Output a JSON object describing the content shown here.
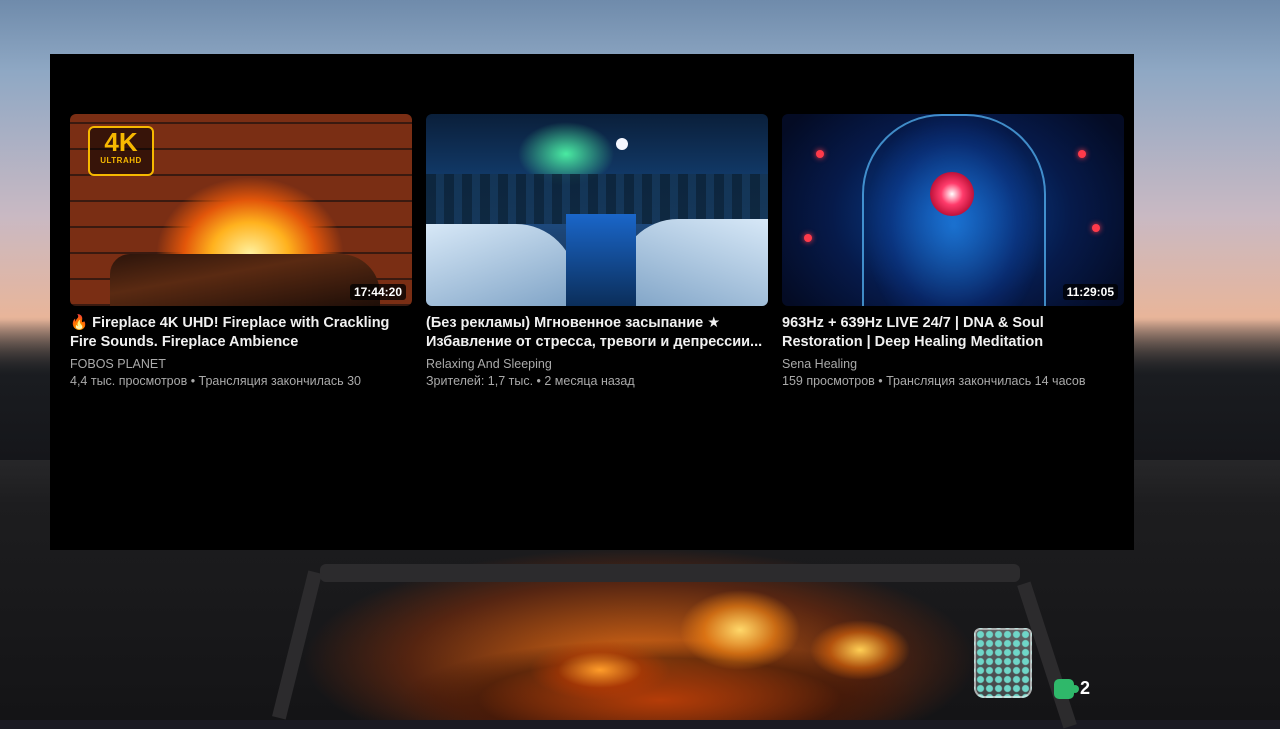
{
  "end_screen": {
    "cards": [
      {
        "title": "🔥 Fireplace 4K UHD! Fireplace with Crackling Fire Sounds. Fireplace Ambience",
        "channel": "FOBOS PLANET",
        "meta": "4,4 тыс. просмотров • Трансляция закончилась 30",
        "duration": "17:44:20",
        "badge_main": "4K",
        "badge_sub": "ULTRAHD"
      },
      {
        "title": "(Без рекламы) Мгновенное засыпание ★ Избавление от стресса, тревоги и депрессии...",
        "channel": "Relaxing And Sleeping",
        "meta": "Зрителей: 1,7 тыс. • 2 месяца назад"
      },
      {
        "title": "963Hz + 639Hz LIVE 24/7 | DNA & Soul Restoration | Deep Healing Meditation",
        "channel": "Sena Healing",
        "meta": "159 просмотров • Трансляция закончилась 14 часов",
        "duration": "11:29:05"
      }
    ]
  },
  "widgets": {
    "counter_value": "2",
    "counter_icon": "puzzle-icon",
    "jar_icon": "jar-icon"
  }
}
